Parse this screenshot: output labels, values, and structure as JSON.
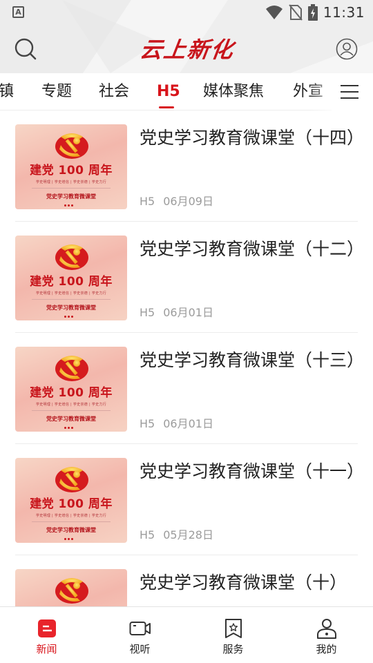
{
  "status_bar": {
    "time": "11:31",
    "left_icon_text": "A"
  },
  "header": {
    "logo_text": "云上新化"
  },
  "tabs": [
    {
      "label": "镇"
    },
    {
      "label": "专题"
    },
    {
      "label": "社会"
    },
    {
      "label": "H5",
      "active": true
    },
    {
      "label": "媒体聚焦"
    },
    {
      "label": "外宣"
    }
  ],
  "thumbnail": {
    "headline": "建党 100 周年",
    "subline": "学史明理 | 学史增信 | 学史崇德 | 学史力行",
    "bottom": "党史学习教育微课堂"
  },
  "news_items": [
    {
      "title": "党史学习教育微课堂（十四）",
      "category": "H5",
      "date": "06月09日"
    },
    {
      "title": "党史学习教育微课堂（十二）",
      "category": "H5",
      "date": "06月01日"
    },
    {
      "title": "党史学习教育微课堂（十三）",
      "category": "H5",
      "date": "06月01日"
    },
    {
      "title": "党史学习教育微课堂（十一）",
      "category": "H5",
      "date": "05月28日"
    },
    {
      "title": "党史学习教育微课堂（十）",
      "category": "",
      "date": ""
    }
  ],
  "bottom_nav": [
    {
      "label": "新闻",
      "icon": "news-icon",
      "active": true
    },
    {
      "label": "视听",
      "icon": "video-icon"
    },
    {
      "label": "服务",
      "icon": "service-icon"
    },
    {
      "label": "我的",
      "icon": "profile-icon"
    }
  ],
  "colors": {
    "accent": "#d8141b",
    "text": "#222222",
    "meta": "#9b9b9b"
  }
}
